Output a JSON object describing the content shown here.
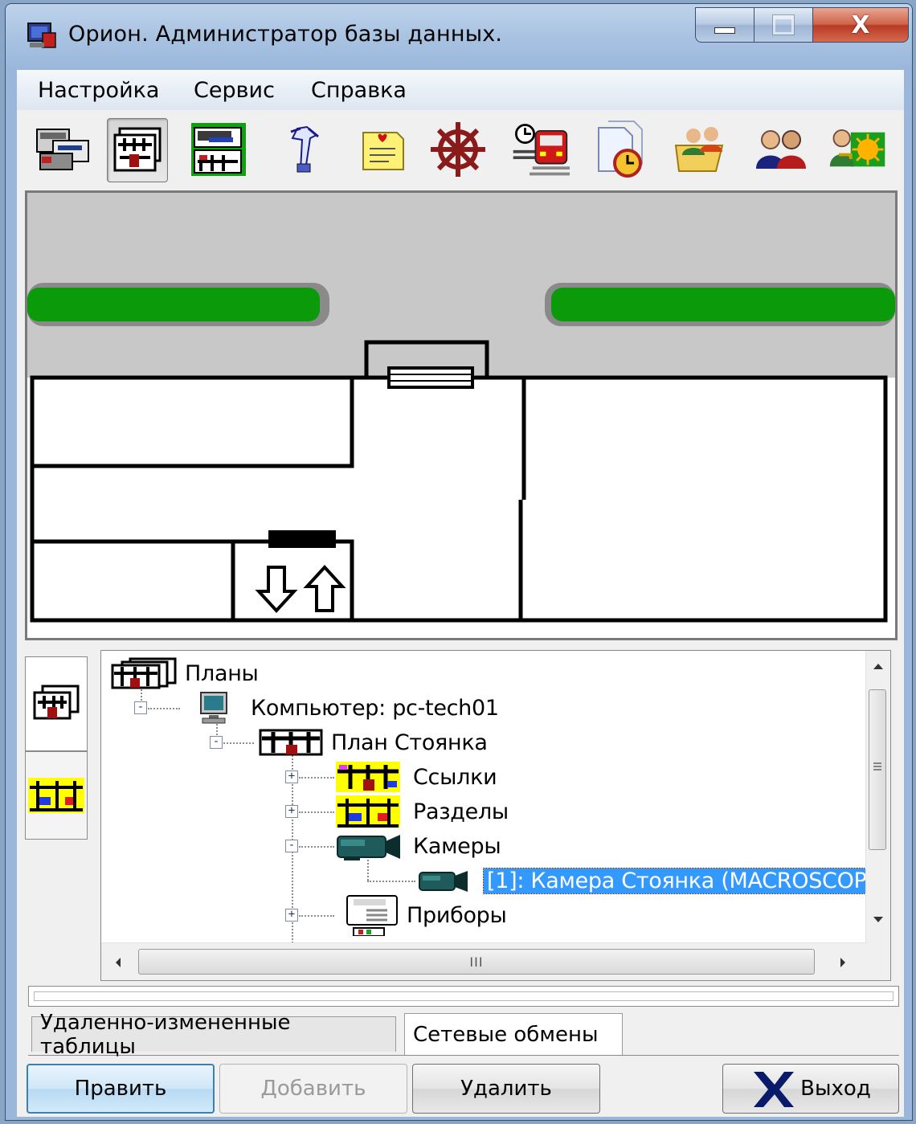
{
  "window": {
    "title": "Орион. Администратор базы данных.",
    "caption_buttons": {
      "minimize": "minimize",
      "maximize": "maximize",
      "close": "X"
    }
  },
  "menu": {
    "items": [
      {
        "label": "Настройка"
      },
      {
        "label": "Сервис"
      },
      {
        "label": "Справка"
      }
    ]
  },
  "toolbar": {
    "buttons": [
      {
        "icon": "devices-icon"
      },
      {
        "icon": "plans-icon",
        "pressed": true
      },
      {
        "icon": "panel-icon"
      },
      {
        "icon": "keyholder-icon"
      },
      {
        "icon": "notepad-icon"
      },
      {
        "icon": "helm-wheel-icon"
      },
      {
        "icon": "train-schedule-icon"
      },
      {
        "icon": "calendar-alarm-icon"
      },
      {
        "icon": "users-folder-icon"
      },
      {
        "icon": "user-group-icon"
      },
      {
        "icon": "user-key-icon"
      }
    ]
  },
  "tree": {
    "items": [
      {
        "label": "Планы",
        "level": 0,
        "icon": "plans-icon"
      },
      {
        "label": "Компьютер: pc-tech01",
        "level": 1,
        "icon": "computer-icon",
        "expander": "-"
      },
      {
        "label": "План Стоянка",
        "level": 2,
        "icon": "plan-icon",
        "expander": "-"
      },
      {
        "label": "Ссылки",
        "level": 3,
        "icon": "links-icon",
        "expander": "+"
      },
      {
        "label": "Разделы",
        "level": 3,
        "icon": "sections-icon",
        "expander": "+"
      },
      {
        "label": "Камеры",
        "level": 3,
        "icon": "camera-icon",
        "expander": "-"
      },
      {
        "label": "[1]: Камера Стоянка (MACROSCOP",
        "level": 4,
        "icon": "camera-icon",
        "selected": true
      },
      {
        "label": "Приборы",
        "level": 3,
        "icon": "device-icon",
        "expander": "+"
      }
    ],
    "hscroll_grip": "III"
  },
  "bottom_tabs": [
    {
      "label": "Удаленно-измененные таблицы",
      "active": false
    },
    {
      "label": "Сетевые обмены",
      "active": true
    }
  ],
  "buttons": {
    "edit": "Править",
    "add": "Добавить",
    "delete": "Удалить",
    "exit": "Выход"
  },
  "colors": {
    "title_bar": "#a9c3e2",
    "selection": "#3399ff",
    "plan_grass": "#0a9a0a",
    "plan_road": "#c8c8c8"
  }
}
